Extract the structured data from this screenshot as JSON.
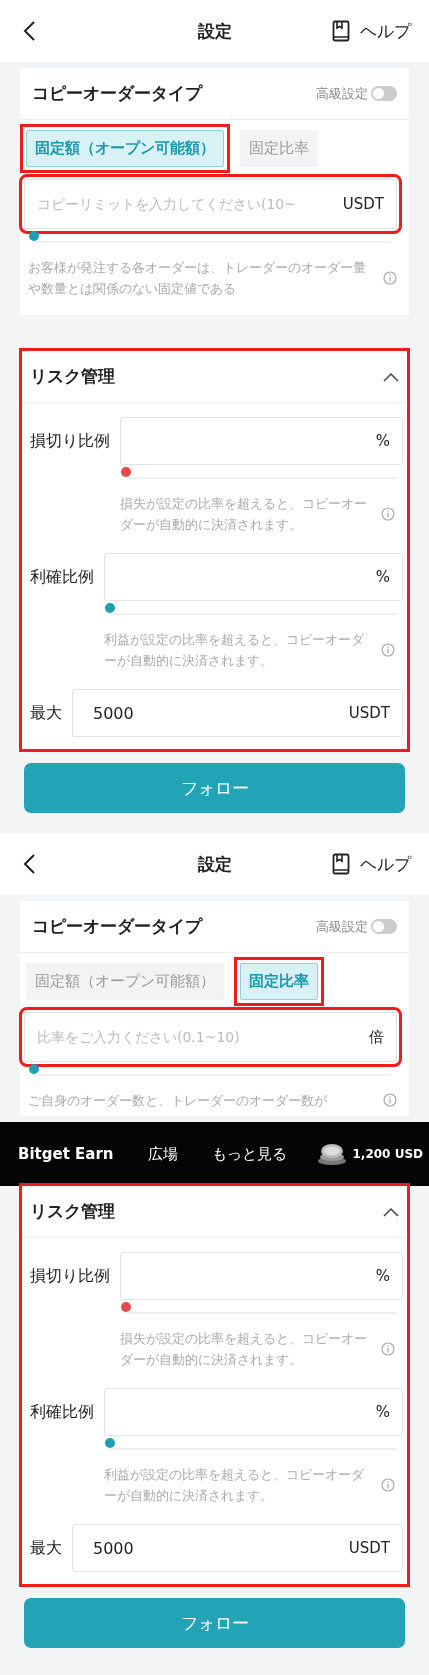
{
  "screens": [
    {
      "header": {
        "title": "設定",
        "help": "ヘルプ"
      },
      "copy_order": {
        "title": "コピーオーダータイプ",
        "advanced": {
          "label": "高級設定",
          "on": false
        },
        "tabs": [
          {
            "label": "固定額（オープン可能額）",
            "selected": true,
            "highlighted": true
          },
          {
            "label": "固定比率",
            "selected": false,
            "highlighted": false
          }
        ],
        "input": {
          "placeholder": "コピーリミットを入力してください(10~",
          "unit": "USDT",
          "highlighted": true
        },
        "slider": {
          "level": 0
        },
        "description": "お客様が発注する各オーダーは、トレーダーのオーダー量や数量とは関係のない固定値である"
      },
      "risk": {
        "title": "リスク管理",
        "expanded": true,
        "highlighted": true,
        "items": [
          {
            "kind": "ratio",
            "label": "損切り比例",
            "unit": "%",
            "slider": {
              "level": 0,
              "color": "#e84a4a"
            },
            "description": "損失が設定の比率を超えると、コピーオーダーが自動的に決済されます。"
          },
          {
            "kind": "ratio",
            "label": "利確比例",
            "unit": "%",
            "slider": {
              "level": 0,
              "color": "#1f9fb3"
            },
            "description": "利益が設定の比率を超えると、コピーオーダーが自動的に決済されます。"
          },
          {
            "kind": "amount",
            "label": "最大",
            "value": "5000",
            "unit": "USDT"
          }
        ]
      },
      "follow_button": "フォロー"
    },
    {
      "header": {
        "title": "設定",
        "help": "ヘルプ"
      },
      "copy_order": {
        "title": "コピーオーダータイプ",
        "advanced": {
          "label": "高級設定",
          "on": false
        },
        "tabs": [
          {
            "label": "固定額（オープン可能額）",
            "selected": false,
            "highlighted": false
          },
          {
            "label": "固定比率",
            "selected": true,
            "highlighted": true
          }
        ],
        "input": {
          "placeholder": "比率をご入力ください(0.1~10)",
          "unit": "倍",
          "highlighted": true
        },
        "slider": {
          "level": 0
        },
        "description": "ご自身のオーダー数と、トレーダーのオーダー数が"
      },
      "banner": {
        "items": [
          {
            "kind": "brand",
            "label": "Bitget Earn"
          },
          {
            "kind": "link",
            "label": "広場"
          },
          {
            "kind": "link",
            "label": "もっと見る"
          },
          {
            "kind": "reward",
            "label": "1,200 USD"
          }
        ]
      },
      "risk": {
        "title": "リスク管理",
        "expanded": true,
        "highlighted": true,
        "items": [
          {
            "kind": "ratio",
            "label": "損切り比例",
            "unit": "%",
            "slider": {
              "level": 0,
              "color": "#e84a4a"
            },
            "description": "損失が設定の比率を超えると、コピーオーダーが自動的に決済されます。"
          },
          {
            "kind": "ratio",
            "label": "利確比例",
            "unit": "%",
            "slider": {
              "level": 0,
              "color": "#1f9fb3"
            },
            "description": "利益が設定の比率を超えると、コピーオーダーが自動的に決済されます。"
          },
          {
            "kind": "amount",
            "label": "最大",
            "value": "5000",
            "unit": "USDT"
          }
        ]
      },
      "follow_button": "フォロー"
    }
  ]
}
